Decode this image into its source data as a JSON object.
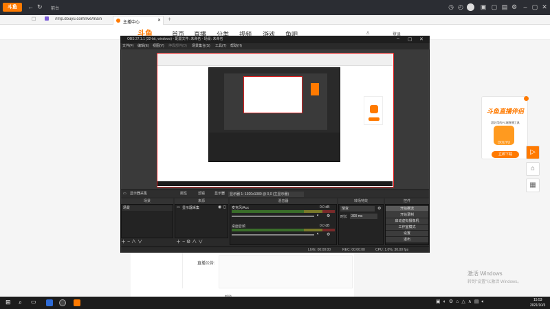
{
  "browser": {
    "tab_title": "主播中心",
    "address": "//mp.douyu.com/live/main",
    "nav_label": "前台",
    "login_text": "登录",
    "site_logo": "斗鱼"
  },
  "site": {
    "nav": [
      "首页",
      "直播",
      "分类",
      "视频",
      "游戏",
      "鱼吧"
    ],
    "stream_name_label": "直播公告:",
    "bottom_label": "帮助"
  },
  "obs": {
    "title": "OBS 27.1.1 (32-bit, windows) - 配置文件: 未命名 - 场景: 未命名",
    "menu": [
      "文件(F)",
      "编辑(E)",
      "视图(V)",
      "停靠部件(D)",
      "场景集合(S)",
      "工具(T)",
      "帮助(H)"
    ],
    "source_toolbar": {
      "source_label": "显示器采集",
      "properties": "属性",
      "filters": "滤镜",
      "display_label": "显示器",
      "display_value": "显示器 1: 1920x1080 @ 0,0 (主显示器)"
    },
    "docks": {
      "scenes": "场景",
      "sources": "来源",
      "mixer": "混音器",
      "transitions": "转场特效",
      "controls": "控件"
    },
    "scenes_list": [
      "场景"
    ],
    "sources_list": [
      "显示器采集"
    ],
    "mixer": {
      "tracks": [
        {
          "name": "麦克风/Aux",
          "db": "0.0 dB"
        },
        {
          "name": "桌面音频",
          "db": "0.0 dB"
        }
      ]
    },
    "transition": {
      "type": "渐变",
      "duration_label": "时长",
      "duration_value": "300 ms"
    },
    "controls": [
      "开始推流",
      "开始录制",
      "启动虚拟摄像机",
      "工作室模式",
      "设置",
      "退出"
    ],
    "status": {
      "live": "LIVE: 00:00:00",
      "rec": "REC: 00:00:00",
      "cpu": "CPU: 1.0%, 30.00 fps"
    }
  },
  "promo": {
    "title": "斗鱼直播伴侣",
    "subtitle": "超好用的PC端直播工具",
    "button": "立即下载",
    "logo_text": "DOUYU"
  },
  "watermark": {
    "line1": "激活 Windows",
    "line2": "转到\"设置\"以激活 Windows。"
  },
  "taskbar": {
    "time": "15:53",
    "date": "2021/10/3"
  },
  "colors": {
    "accent_orange": "#ff7a00",
    "capture_border": "#e02020",
    "obs_bg": "#2a2a2a"
  }
}
